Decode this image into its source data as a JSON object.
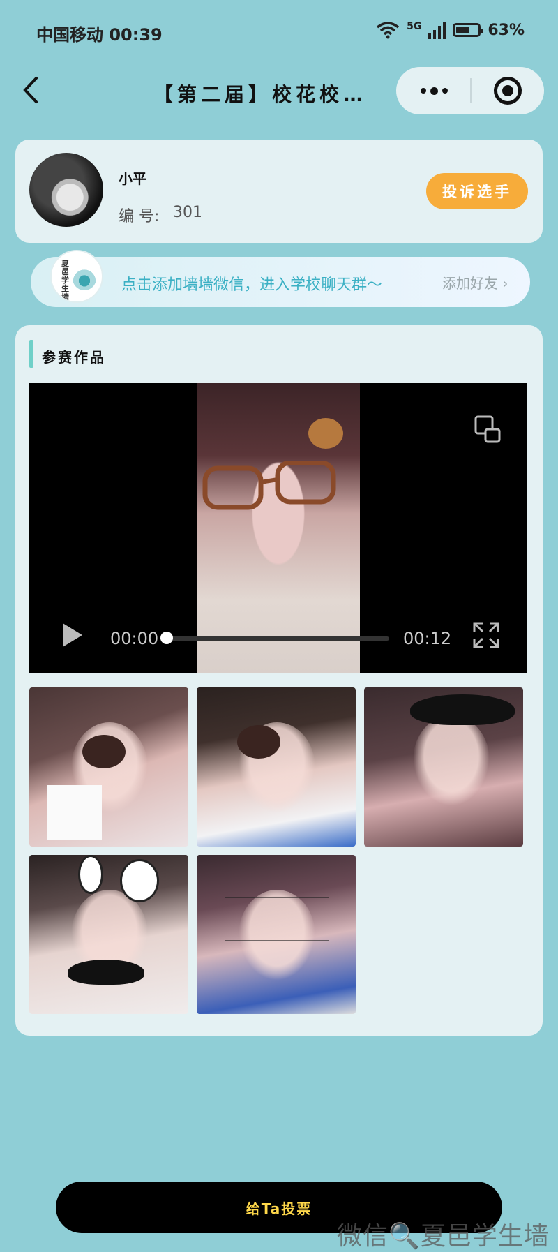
{
  "status_bar": {
    "carrier_time": "中国移动 00:39",
    "network": "5G",
    "battery": "63%"
  },
  "nav": {
    "title": "【第二届】校花校…"
  },
  "profile": {
    "name": "小平",
    "number_label": "编 号:",
    "number": "301",
    "report_label": "投诉选手"
  },
  "banner": {
    "logo_text": "夏邑学生墙",
    "text": "点击添加墙墙微信，进入学校聊天群～",
    "action": "添加好友 ›"
  },
  "works": {
    "section_title": "参赛作品",
    "video": {
      "current_time": "00:00",
      "duration": "00:12",
      "progress": 0
    },
    "thumbnails": [
      {
        "name": "photo-1"
      },
      {
        "name": "photo-2"
      },
      {
        "name": "photo-3"
      },
      {
        "name": "photo-4"
      },
      {
        "name": "photo-5"
      }
    ]
  },
  "vote_label": "给Ta投票",
  "watermark": "微信🔍夏邑学生墙",
  "colors": {
    "background": "#8fced6",
    "card": "#e4f1f3",
    "accent_orange": "#f7ac3a",
    "vote_text": "#ffd84a"
  }
}
